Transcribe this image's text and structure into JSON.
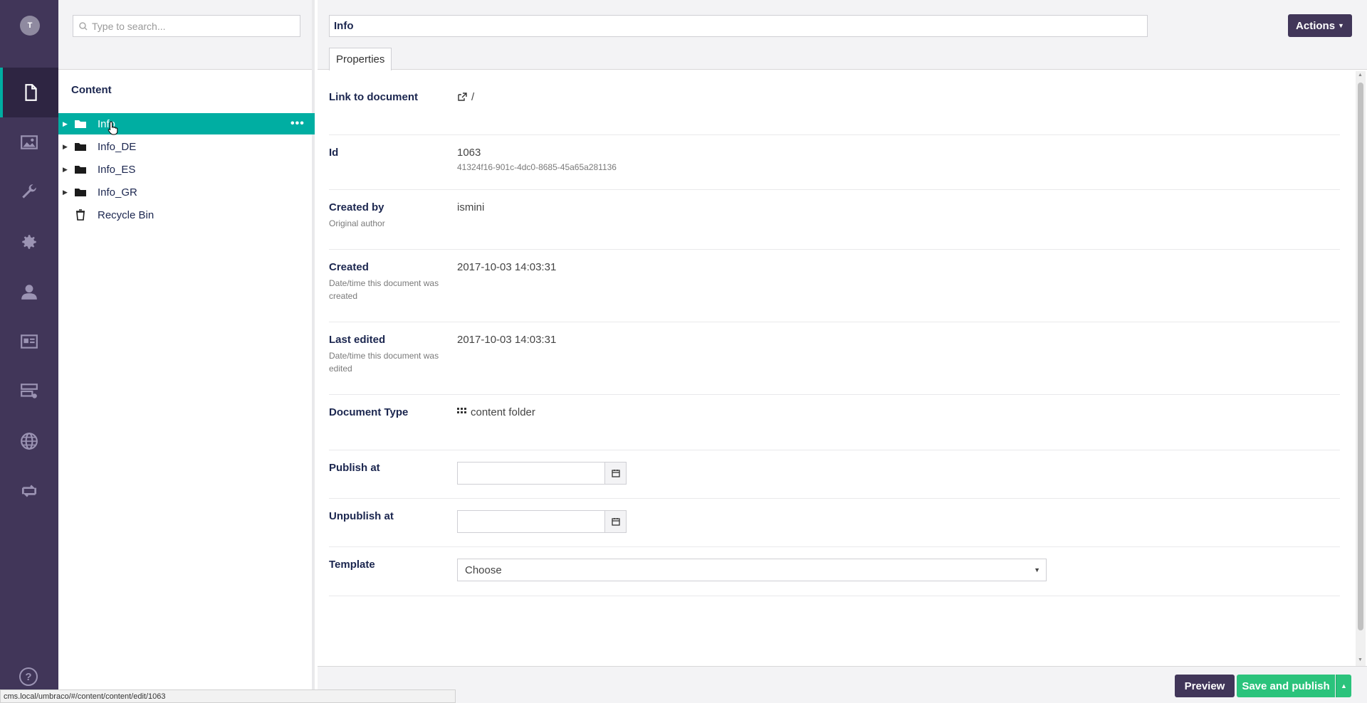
{
  "user": {
    "initial": "T"
  },
  "sections": [
    {
      "name": "content",
      "icon": "document-icon",
      "active": true
    },
    {
      "name": "media",
      "icon": "image-icon"
    },
    {
      "name": "settings-tools",
      "icon": "wrench-icon"
    },
    {
      "name": "developer",
      "icon": "gear-icon"
    },
    {
      "name": "users",
      "icon": "user-icon"
    },
    {
      "name": "members",
      "icon": "id-card-icon"
    },
    {
      "name": "forms",
      "icon": "form-icon"
    },
    {
      "name": "translation",
      "icon": "globe-icon"
    },
    {
      "name": "deploy",
      "icon": "sync-icon"
    }
  ],
  "help": {
    "label": "?"
  },
  "tree": {
    "search_placeholder": "Type to search...",
    "title": "Content",
    "items": [
      {
        "label": "Info",
        "icon": "folder-icon",
        "selected": true,
        "has_children": true
      },
      {
        "label": "Info_DE",
        "icon": "folder-icon",
        "has_children": true
      },
      {
        "label": "Info_ES",
        "icon": "folder-icon",
        "has_children": true
      },
      {
        "label": "Info_GR",
        "icon": "folder-icon",
        "has_children": true
      },
      {
        "label": "Recycle Bin",
        "icon": "trash-icon",
        "has_children": false
      }
    ],
    "options_label": "•••"
  },
  "editor": {
    "name_value": "Info",
    "actions_label": "Actions",
    "tab_label": "Properties",
    "properties": {
      "link": {
        "label": "Link to document",
        "value": "/"
      },
      "id": {
        "label": "Id",
        "value": "1063",
        "guid": "41324f16-901c-4dc0-8685-45a65a281136"
      },
      "created_by": {
        "label": "Created by",
        "desc": "Original author",
        "value": "ismini"
      },
      "created": {
        "label": "Created",
        "desc": "Date/time this document was created",
        "value": "2017-10-03 14:03:31"
      },
      "last_edited": {
        "label": "Last edited",
        "desc": "Date/time this document was edited",
        "value": "2017-10-03 14:03:31"
      },
      "doc_type": {
        "label": "Document Type",
        "value": "content folder"
      },
      "publish_at": {
        "label": "Publish at",
        "value": ""
      },
      "unpublish_at": {
        "label": "Unpublish at",
        "value": ""
      },
      "template": {
        "label": "Template",
        "value": "Choose"
      }
    }
  },
  "footer": {
    "preview_label": "Preview",
    "save_publish_label": "Save and publish"
  },
  "statusbar": {
    "url": "cms.local/umbraco/#/content/content/edit/1063"
  },
  "colors": {
    "rail": "#413659",
    "accent": "#00aea2",
    "save": "#2bc37c"
  }
}
